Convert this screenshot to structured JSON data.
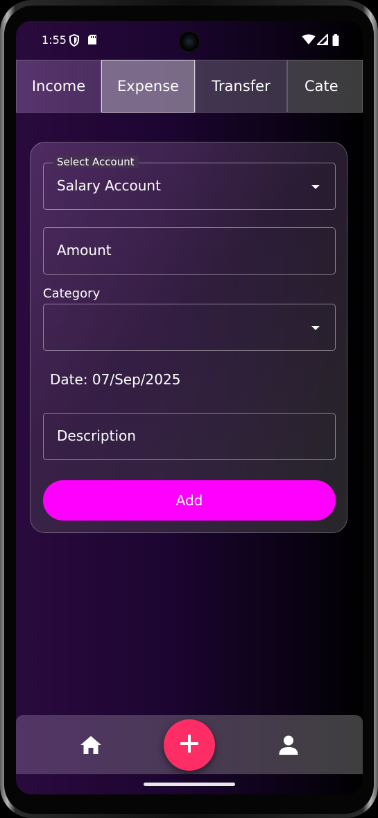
{
  "status_bar": {
    "time": "1:55",
    "icons": [
      "shield-icon",
      "sd-card-icon",
      "wifi-icon",
      "signal-icon",
      "battery-icon"
    ]
  },
  "tabs": [
    {
      "label": "Income",
      "selected": false
    },
    {
      "label": "Expense",
      "selected": true
    },
    {
      "label": "Transfer",
      "selected": false
    },
    {
      "label": "Cate",
      "selected": false
    }
  ],
  "form": {
    "account": {
      "legend": "Select Account",
      "value": "Salary Account"
    },
    "amount": {
      "placeholder": "Amount"
    },
    "category": {
      "label": "Category",
      "value": ""
    },
    "date_text": "Date: 07/Sep/2025",
    "description": {
      "placeholder": "Description"
    },
    "submit_label": "Add"
  },
  "bottom_nav": {
    "items": [
      "home-icon",
      "plus-icon",
      "person-icon"
    ]
  },
  "colors": {
    "accent": "#ff00ff",
    "fab": "#ff2d66"
  }
}
